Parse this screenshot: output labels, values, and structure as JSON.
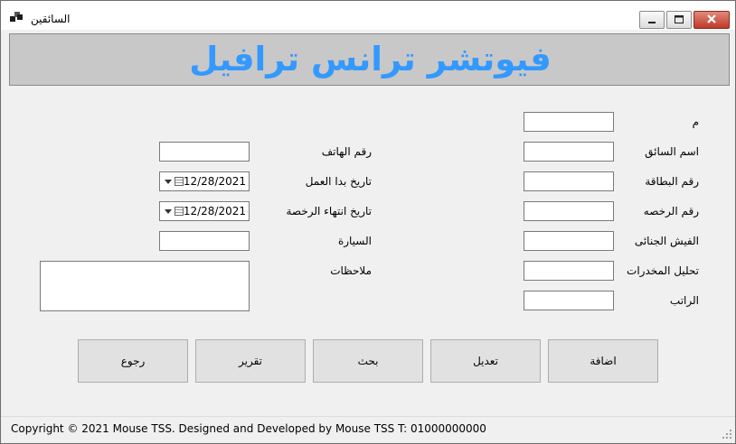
{
  "window": {
    "title": "السائقين"
  },
  "banner": {
    "title": "فيوتشر ترانس ترافيل"
  },
  "fields_right": [
    {
      "label": "م",
      "value": ""
    },
    {
      "label": "اسم السائق",
      "value": ""
    },
    {
      "label": "رقم البطاقة",
      "value": ""
    },
    {
      "label": "رقم الرخصه",
      "value": ""
    },
    {
      "label": "الفيش الجنائى",
      "value": ""
    },
    {
      "label": "تحليل المخدرات",
      "value": ""
    },
    {
      "label": "الراتب",
      "value": ""
    }
  ],
  "fields_left": {
    "phone": {
      "label": "رقم الهاتف",
      "value": ""
    },
    "start_date": {
      "label": "تاريخ بدا العمل",
      "value": "12/28/2021"
    },
    "license_expiry": {
      "label": "تاريخ انتهاء الرخصة",
      "value": "12/28/2021"
    },
    "car": {
      "label": "السيارة",
      "value": ""
    },
    "notes": {
      "label": "ملاحظات",
      "value": ""
    }
  },
  "buttons": {
    "add": "اضافة",
    "edit": "تعديل",
    "search": "بحث",
    "report": "تقرير",
    "back": "رجوع"
  },
  "status": {
    "text": "Copyright © 2021 Mouse TSS.   Designed and Developed by Mouse TSS   T: 01000000000"
  }
}
